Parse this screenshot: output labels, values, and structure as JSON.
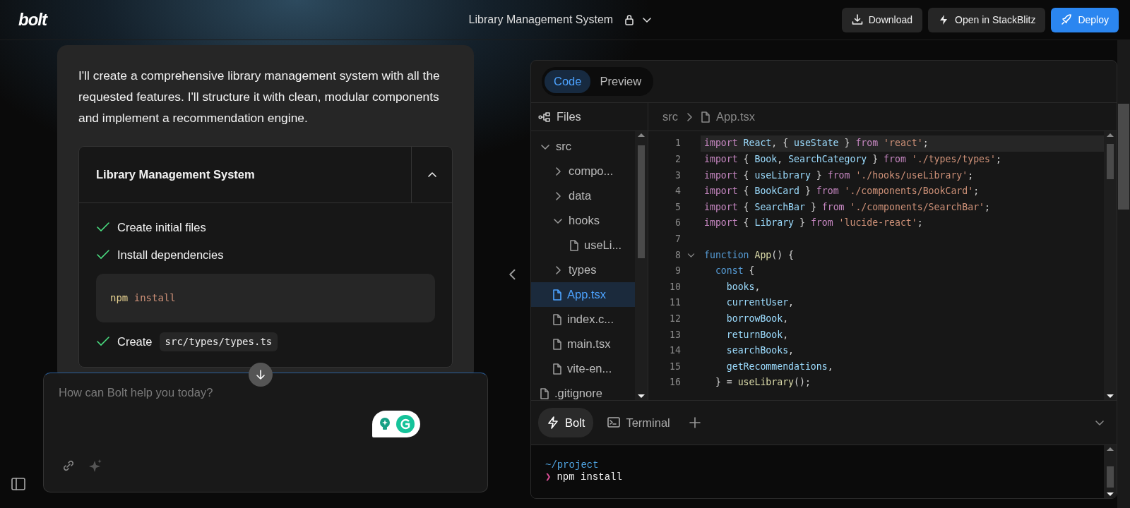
{
  "header": {
    "logo": "bolt",
    "title": "Library Management System",
    "buttons": [
      {
        "label": "Download",
        "primary": false
      },
      {
        "label": "Open in StackBlitz",
        "primary": false
      },
      {
        "label": "Deploy",
        "primary": true
      }
    ]
  },
  "chat": {
    "message": "I'll create a comprehensive library management system with all the requested features. I'll structure it with clean, modular components and implement a recommendation engine.",
    "artifact": {
      "title": "Library Management System",
      "expanded": true,
      "steps": [
        {
          "kind": "text",
          "done": true,
          "label": "Create initial files"
        },
        {
          "kind": "text",
          "done": true,
          "label": "Install dependencies"
        },
        {
          "kind": "command",
          "command": "npm",
          "args": "install"
        },
        {
          "kind": "file",
          "done": true,
          "label": "Create",
          "path": "src/types/types.ts"
        }
      ]
    },
    "prompt": {
      "placeholder": "How can Bolt help you today?"
    }
  },
  "workbench": {
    "views": [
      {
        "label": "Code",
        "selected": true
      },
      {
        "label": "Preview",
        "selected": false
      }
    ],
    "files_label": "Files",
    "tree": [
      {
        "kind": "folder",
        "name": "src",
        "expanded": true,
        "children": [
          {
            "kind": "folder",
            "name": "compo...",
            "expanded": false
          },
          {
            "kind": "folder",
            "name": "data",
            "expanded": false
          },
          {
            "kind": "folder",
            "name": "hooks",
            "expanded": true,
            "children": [
              {
                "kind": "file",
                "name": "useLi...",
                "selected": false
              }
            ]
          },
          {
            "kind": "folder",
            "name": "types",
            "expanded": false
          },
          {
            "kind": "file",
            "name": "App.tsx",
            "selected": true
          },
          {
            "kind": "file",
            "name": "index.c...",
            "selected": false
          },
          {
            "kind": "file",
            "name": "main.tsx",
            "selected": false
          },
          {
            "kind": "file",
            "name": "vite-en...",
            "selected": false
          }
        ]
      },
      {
        "kind": "file",
        "name": ".gitignore",
        "selected": false
      }
    ],
    "breadcrumb": [
      "src",
      "App.tsx"
    ],
    "code": [
      {
        "n": "1",
        "current": true,
        "fold": false,
        "tokens": [
          {
            "text": "import ",
            "kind": "kw"
          },
          {
            "text": "React",
            "kind": "id"
          },
          {
            "text": ", { ",
            "kind": "p"
          },
          {
            "text": "useState",
            "kind": "id"
          },
          {
            "text": " } ",
            "kind": "p"
          },
          {
            "text": "from ",
            "kind": "kw"
          },
          {
            "text": "'react'",
            "kind": "str"
          },
          {
            "text": ";",
            "kind": "p"
          }
        ]
      },
      {
        "n": "2",
        "current": false,
        "fold": false,
        "tokens": [
          {
            "text": "import ",
            "kind": "kw"
          },
          {
            "text": "{ ",
            "kind": "p"
          },
          {
            "text": "Book",
            "kind": "id"
          },
          {
            "text": ", ",
            "kind": "p"
          },
          {
            "text": "SearchCategory",
            "kind": "id"
          },
          {
            "text": " } ",
            "kind": "p"
          },
          {
            "text": "from ",
            "kind": "kw"
          },
          {
            "text": "'./types/types'",
            "kind": "str"
          },
          {
            "text": ";",
            "kind": "p"
          }
        ]
      },
      {
        "n": "3",
        "current": false,
        "fold": false,
        "tokens": [
          {
            "text": "import ",
            "kind": "kw"
          },
          {
            "text": "{ ",
            "kind": "p"
          },
          {
            "text": "useLibrary",
            "kind": "id"
          },
          {
            "text": " } ",
            "kind": "p"
          },
          {
            "text": "from ",
            "kind": "kw"
          },
          {
            "text": "'./hooks/useLibrary'",
            "kind": "str"
          },
          {
            "text": ";",
            "kind": "p"
          }
        ]
      },
      {
        "n": "4",
        "current": false,
        "fold": false,
        "tokens": [
          {
            "text": "import ",
            "kind": "kw"
          },
          {
            "text": "{ ",
            "kind": "p"
          },
          {
            "text": "BookCard",
            "kind": "id"
          },
          {
            "text": " } ",
            "kind": "p"
          },
          {
            "text": "from ",
            "kind": "kw"
          },
          {
            "text": "'./components/BookCard'",
            "kind": "str"
          },
          {
            "text": ";",
            "kind": "p"
          }
        ]
      },
      {
        "n": "5",
        "current": false,
        "fold": false,
        "tokens": [
          {
            "text": "import ",
            "kind": "kw"
          },
          {
            "text": "{ ",
            "kind": "p"
          },
          {
            "text": "SearchBar",
            "kind": "id"
          },
          {
            "text": " } ",
            "kind": "p"
          },
          {
            "text": "from ",
            "kind": "kw"
          },
          {
            "text": "'./components/SearchBar'",
            "kind": "str"
          },
          {
            "text": ";",
            "kind": "p"
          }
        ]
      },
      {
        "n": "6",
        "current": false,
        "fold": false,
        "tokens": [
          {
            "text": "import ",
            "kind": "kw"
          },
          {
            "text": "{ ",
            "kind": "p"
          },
          {
            "text": "Library",
            "kind": "id"
          },
          {
            "text": " } ",
            "kind": "p"
          },
          {
            "text": "from ",
            "kind": "kw"
          },
          {
            "text": "'lucide-react'",
            "kind": "str"
          },
          {
            "text": ";",
            "kind": "p"
          }
        ]
      },
      {
        "n": "7",
        "current": false,
        "fold": false
      },
      {
        "n": "8",
        "current": false,
        "fold": true,
        "tokens": [
          {
            "text": "function ",
            "kind": "decl"
          },
          {
            "text": "App",
            "kind": "fn"
          },
          {
            "text": "() {",
            "kind": "p"
          }
        ]
      },
      {
        "n": "9",
        "current": false,
        "fold": false,
        "tokens": [
          {
            "text": "  const ",
            "kind": "decl"
          },
          {
            "text": "{",
            "kind": "p"
          }
        ]
      },
      {
        "n": "10",
        "current": false,
        "fold": false,
        "tokens": [
          {
            "text": "    books",
            "kind": "id"
          },
          {
            "text": ",",
            "kind": "p"
          }
        ]
      },
      {
        "n": "11",
        "current": false,
        "fold": false,
        "tokens": [
          {
            "text": "    currentUser",
            "kind": "id"
          },
          {
            "text": ",",
            "kind": "p"
          }
        ]
      },
      {
        "n": "12",
        "current": false,
        "fold": false,
        "tokens": [
          {
            "text": "    borrowBook",
            "kind": "id"
          },
          {
            "text": ",",
            "kind": "p"
          }
        ]
      },
      {
        "n": "13",
        "current": false,
        "fold": false,
        "tokens": [
          {
            "text": "    returnBook",
            "kind": "id"
          },
          {
            "text": ",",
            "kind": "p"
          }
        ]
      },
      {
        "n": "14",
        "current": false,
        "fold": false,
        "tokens": [
          {
            "text": "    searchBooks",
            "kind": "id"
          },
          {
            "text": ",",
            "kind": "p"
          }
        ]
      },
      {
        "n": "15",
        "current": false,
        "fold": false,
        "tokens": [
          {
            "text": "    getRecommendations",
            "kind": "id"
          },
          {
            "text": ",",
            "kind": "p"
          }
        ]
      },
      {
        "n": "16",
        "current": false,
        "fold": false,
        "tokens": [
          {
            "text": "  } = ",
            "kind": "p"
          },
          {
            "text": "useLibrary",
            "kind": "fn"
          },
          {
            "text": "();",
            "kind": "p"
          }
        ]
      }
    ],
    "terminal_tabs": [
      {
        "label": "Bolt",
        "selected": true
      },
      {
        "label": "Terminal",
        "selected": false
      }
    ],
    "terminal": {
      "cwd": "~/project",
      "prompt": "❯",
      "command": "npm install"
    }
  }
}
